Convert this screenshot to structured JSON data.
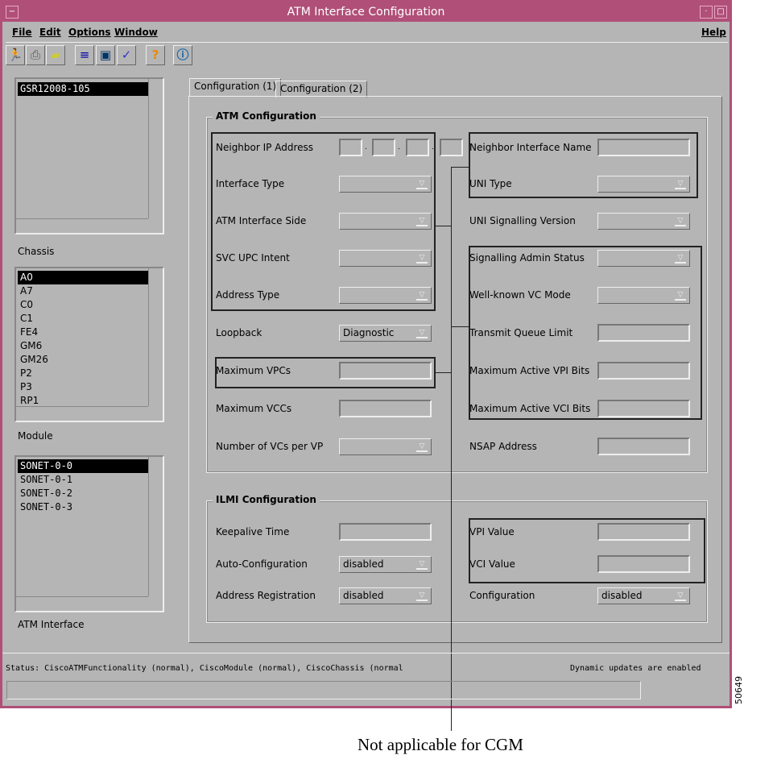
{
  "window": {
    "title": "ATM Interface Configuration"
  },
  "menu": {
    "file": "File",
    "edit": "Edit",
    "options": "Options",
    "window": "Window",
    "help": "Help"
  },
  "toolbar": [
    "exit-icon",
    "print-icon",
    "open-icon",
    "list-icon",
    "monitor-icon",
    "check-icon",
    "help-icon",
    "info-icon"
  ],
  "lists": {
    "devices": {
      "items": [
        "GSR12008-105"
      ],
      "label": "Chassis"
    },
    "chassis": {
      "items": [
        "A0",
        "A7",
        "C0",
        "C1",
        "FE4",
        "GM6",
        "GM26",
        "P2",
        "P3",
        "RP1"
      ],
      "label": "Module"
    },
    "modules": {
      "items": [
        "SONET-0-0",
        "SONET-0-1",
        "SONET-0-2",
        "SONET-0-3"
      ],
      "label": "ATM Interface"
    }
  },
  "tabs": [
    "Configuration (1)",
    "Configuration (2)"
  ],
  "atm": {
    "title": "ATM Configuration",
    "neighbor_ip": "Neighbor IP Address",
    "interface_type": "Interface Type",
    "atm_side": "ATM Interface Side",
    "svc_upc": "SVC UPC Intent",
    "address_type": "Address Type",
    "loopback": "Loopback",
    "loopback_value": "Diagnostic",
    "max_vpcs": "Maximum VPCs",
    "max_vccs": "Maximum VCCs",
    "vcs_per_vp": "Number of VCs per VP",
    "neighbor_if_name": "Neighbor Interface Name",
    "uni_type": "UNI Type",
    "uni_sig_ver": "UNI Signalling Version",
    "sig_admin": "Signalling Admin Status",
    "wk_vc_mode": "Well-known VC Mode",
    "tx_queue": "Transmit Queue Limit",
    "max_vpi_bits": "Maximum Active VPI Bits",
    "max_vci_bits": "Maximum Active VCI Bits",
    "nsap": "NSAP Address"
  },
  "ilmi": {
    "title": "ILMI Configuration",
    "keepalive": "Keepalive Time",
    "auto_config": "Auto-Configuration",
    "auto_config_value": "disabled",
    "addr_reg": "Address Registration",
    "addr_reg_value": "disabled",
    "vpi": "VPI Value",
    "vci": "VCI Value",
    "config": "Configuration",
    "config_value": "disabled"
  },
  "status": {
    "text": "Status: CiscoATMFunctionality (normal), CiscoModule (normal), CiscoChassis (normal",
    "updates": "Dynamic updates are enabled"
  },
  "annotation": "Not applicable for CGM",
  "figure_id": "50649"
}
